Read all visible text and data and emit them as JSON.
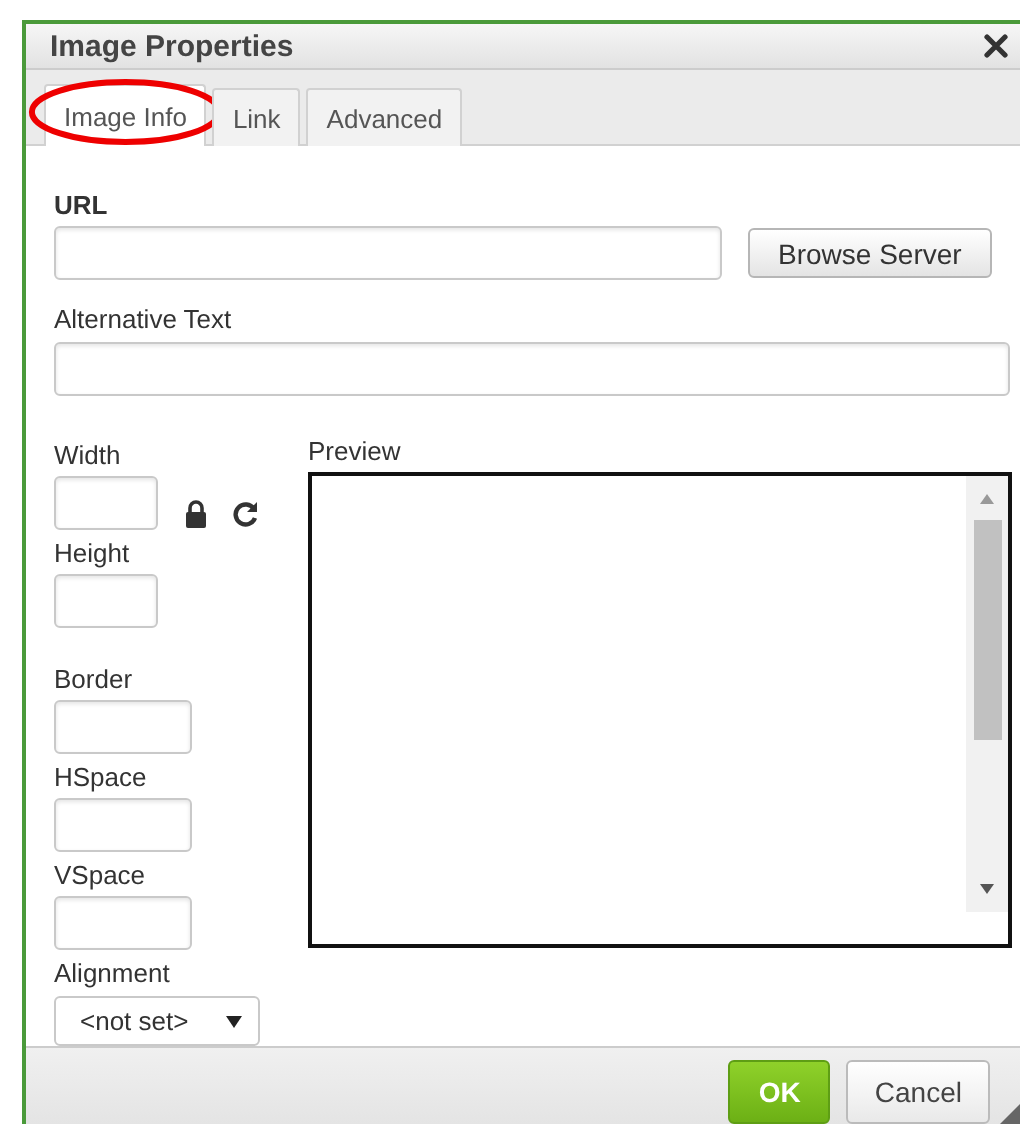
{
  "dialog": {
    "title": "Image Properties"
  },
  "tabs": [
    {
      "label": "Image Info",
      "selected": true,
      "highlighted": true
    },
    {
      "label": "Link",
      "selected": false,
      "highlighted": false
    },
    {
      "label": "Advanced",
      "selected": false,
      "highlighted": false
    }
  ],
  "url": {
    "label": "URL",
    "browse_button": "Browse Server"
  },
  "alt_text": {
    "label": "Alternative Text"
  },
  "size_fields": [
    {
      "label": "Width"
    },
    {
      "label": "Height"
    }
  ],
  "spacing_fields": [
    {
      "label": "Border"
    },
    {
      "label": "HSpace"
    },
    {
      "label": "VSpace"
    }
  ],
  "alignment": {
    "label": "Alignment",
    "value": "<not set>"
  },
  "preview": {
    "label": "Preview"
  },
  "buttons": [
    {
      "label": "OK",
      "kind": "primary"
    },
    {
      "label": "Cancel",
      "kind": "secondary"
    }
  ]
}
